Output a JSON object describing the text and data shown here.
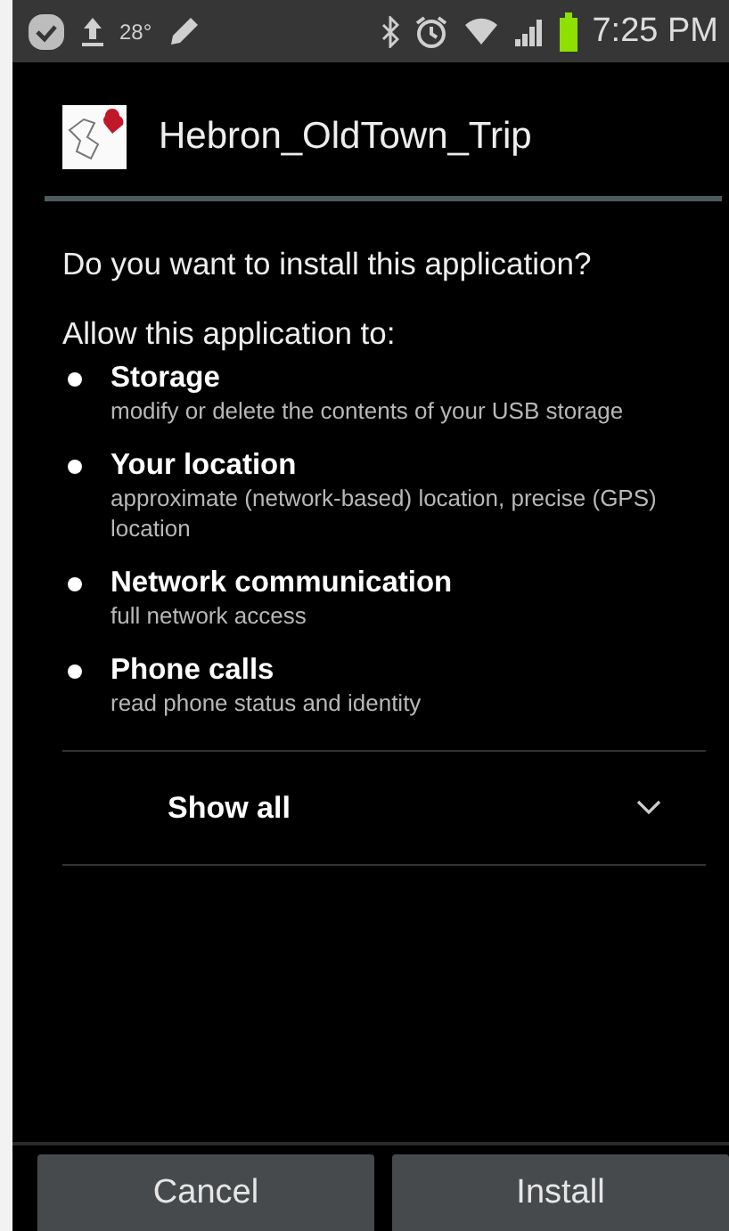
{
  "status_bar": {
    "temperature": "28°",
    "time": "7:25 PM"
  },
  "app": {
    "name": "Hebron_OldTown_Trip"
  },
  "question": "Do you want to install this application?",
  "allow_label": "Allow this application to:",
  "permissions": [
    {
      "title": "Storage",
      "description": "modify or delete the contents of your USB storage"
    },
    {
      "title": "Your location",
      "description": "approximate (network-based) location, precise (GPS) location"
    },
    {
      "title": "Network communication",
      "description": "full network access"
    },
    {
      "title": "Phone calls",
      "description": "read phone status and identity"
    }
  ],
  "show_all": {
    "label": "Show all",
    "expanded": false
  },
  "buttons": [
    {
      "label": "Cancel"
    },
    {
      "label": "Install"
    }
  ]
}
